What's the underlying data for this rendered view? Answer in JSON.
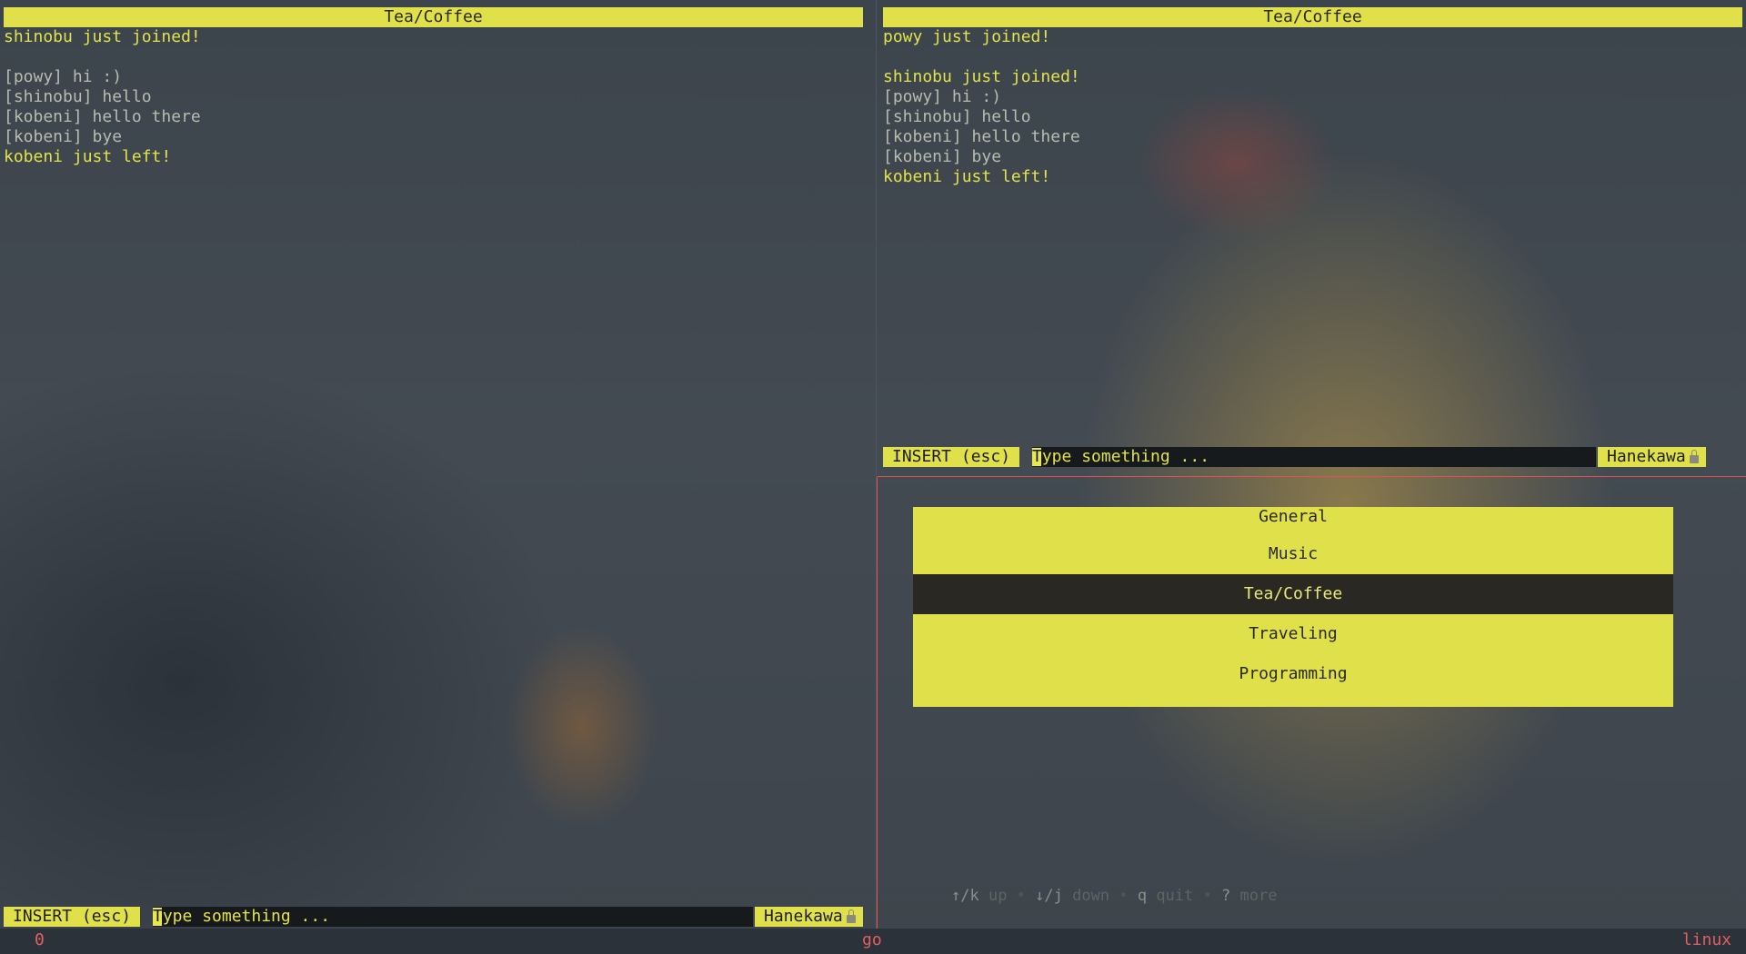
{
  "left_pane": {
    "title": "Tea/Coffee",
    "messages": [
      {
        "type": "sys",
        "text": "shinobu just joined!"
      },
      {
        "type": "blank",
        "text": ""
      },
      {
        "type": "user",
        "text": "[powy] hi :)"
      },
      {
        "type": "user",
        "text": "[shinobu] hello"
      },
      {
        "type": "user",
        "text": "[kobeni] hello there"
      },
      {
        "type": "user",
        "text": "[kobeni] bye"
      },
      {
        "type": "sys",
        "text": "kobeni just left!"
      }
    ],
    "status": {
      "mode": "INSERT (esc)",
      "placeholder_first": "T",
      "placeholder_rest": "ype something ...",
      "nick": "Hanekawa"
    }
  },
  "right_top_pane": {
    "title": "Tea/Coffee",
    "messages": [
      {
        "type": "sys",
        "text": "powy just joined!"
      },
      {
        "type": "blank",
        "text": ""
      },
      {
        "type": "sys",
        "text": "shinobu just joined!"
      },
      {
        "type": "user",
        "text": "[powy] hi :)"
      },
      {
        "type": "user",
        "text": "[shinobu] hello"
      },
      {
        "type": "user",
        "text": "[kobeni] hello there"
      },
      {
        "type": "user",
        "text": "[kobeni] bye"
      },
      {
        "type": "sys",
        "text": "kobeni just left!"
      }
    ],
    "status": {
      "mode": "INSERT (esc)",
      "placeholder_first": "T",
      "placeholder_rest": "ype something ...",
      "nick": "Hanekawa"
    }
  },
  "room_menu": {
    "items": [
      "General",
      "Music",
      "Tea/Coffee",
      "Traveling",
      "Programming"
    ],
    "selected": "Tea/Coffee"
  },
  "help": [
    {
      "key": "↑/k",
      "desc": "up"
    },
    {
      "key": "↓/j",
      "desc": "down"
    },
    {
      "key": "q",
      "desc": "quit"
    },
    {
      "key": "?",
      "desc": "more"
    }
  ],
  "bottom_bar": {
    "left": "0",
    "center": "go",
    "right": "linux"
  },
  "colors": {
    "accent": "#dfe04a",
    "selected_bg": "#2a2822",
    "split_active": "#e05252",
    "background": "#3a424a"
  }
}
